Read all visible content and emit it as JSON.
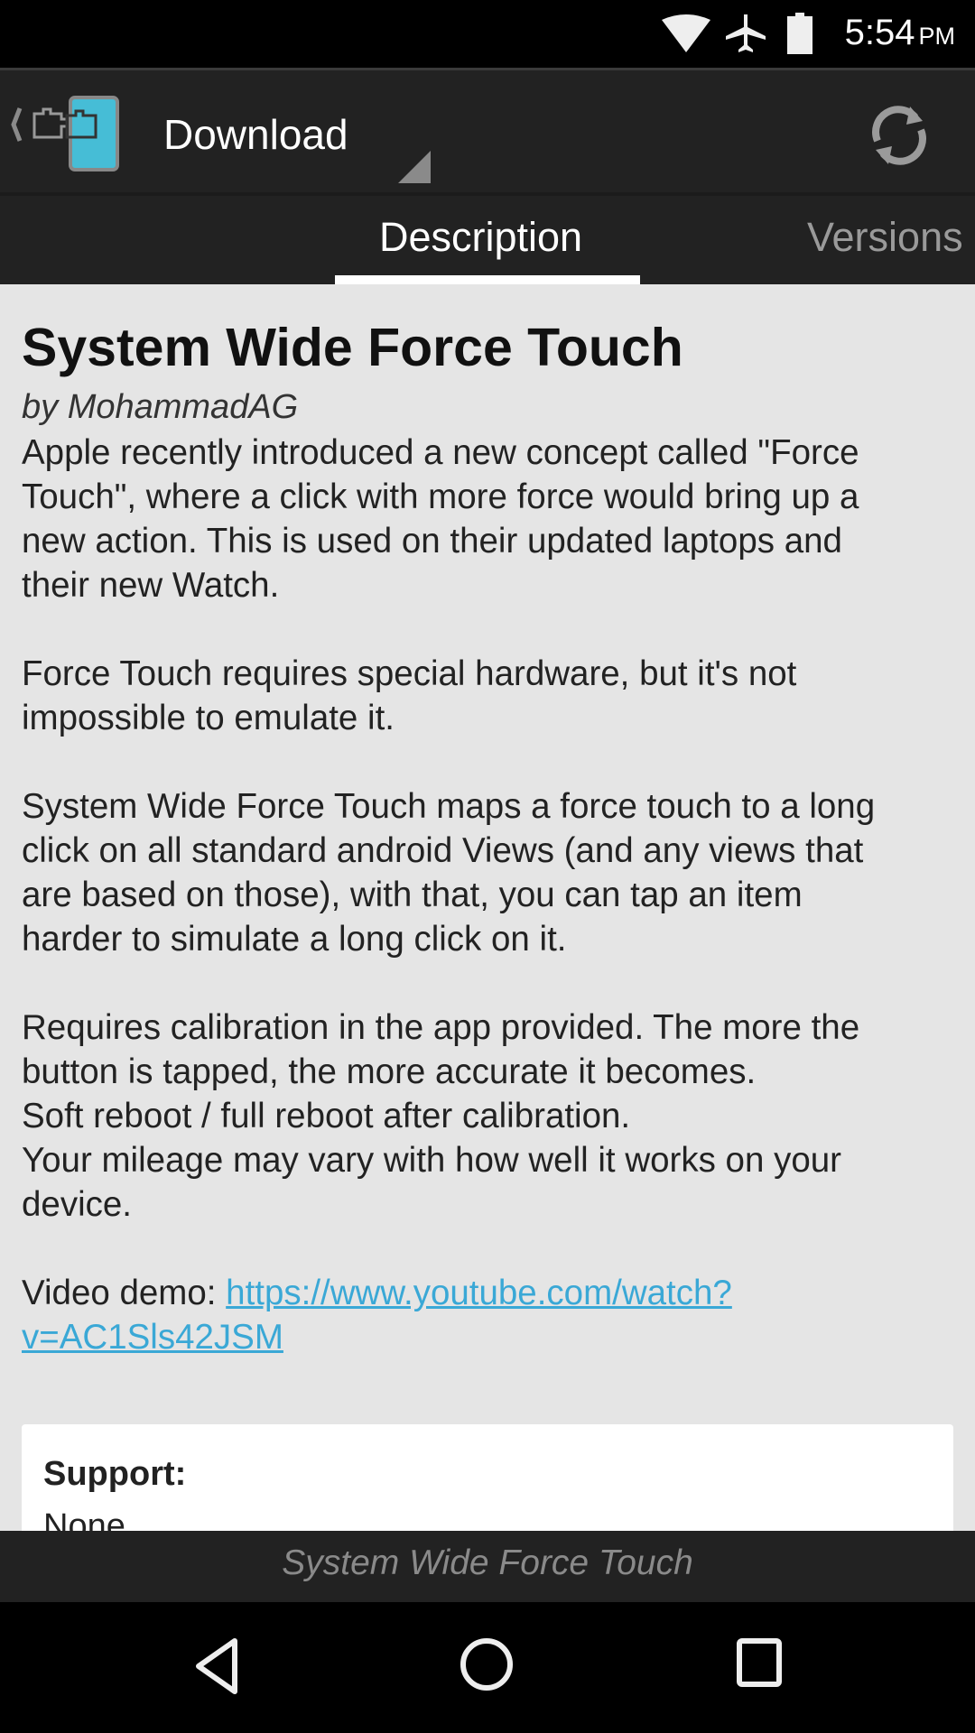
{
  "status_bar": {
    "time": "5:54",
    "ampm": "PM",
    "icons": [
      "wifi-icon",
      "airplane-icon",
      "battery-icon"
    ]
  },
  "toolbar": {
    "title": "Download",
    "app_icon": "xposed-puzzle-icon",
    "refresh_icon": "refresh-icon"
  },
  "tabs": [
    {
      "label": "Description",
      "active": true
    },
    {
      "label": "Versions",
      "active": false
    }
  ],
  "module": {
    "title": "System Wide Force Touch",
    "author": "by MohammadAG",
    "paragraphs": [
      [
        "Apple recently introduced a new concept called \"Force",
        "Touch\", where a click with more force would bring up a",
        "new action. This is used on their updated laptops and",
        "their new Watch."
      ],
      [
        "Force Touch requires special hardware, but it's not",
        "impossible to emulate it."
      ],
      [
        "System Wide Force Touch maps a force touch to a long",
        "click on all standard android Views (and any views that",
        "are based on those), with that, you can tap an item",
        "harder to simulate a long click on it."
      ],
      [
        "Requires calibration in the app provided. The more the",
        "button is tapped, the more accurate it becomes.",
        "Soft reboot / full reboot after calibration.",
        "Your mileage may vary with how well it works on your",
        "device."
      ]
    ],
    "video_label": "Video demo: ",
    "video_link_line1": "https://www.youtube.com/watch?",
    "video_link_line2": "v=AC1Sls42JSM",
    "link_color": "#3aa8d6"
  },
  "support_card": {
    "title": "Support:",
    "value": "None"
  },
  "footer": {
    "text": "System Wide Force Touch"
  },
  "nav_bar": {
    "icons": [
      "back-icon",
      "home-icon",
      "recents-icon"
    ]
  }
}
